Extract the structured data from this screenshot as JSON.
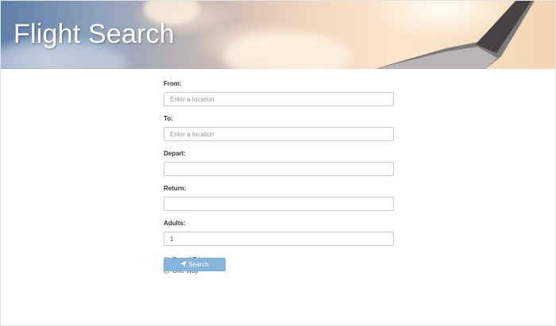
{
  "header": {
    "title": "Flight Search"
  },
  "form": {
    "from": {
      "label": "From:",
      "placeholder": "Enter a location",
      "value": ""
    },
    "to": {
      "label": "To:",
      "placeholder": "Enter a location",
      "value": ""
    },
    "depart": {
      "label": "Depart:",
      "value": ""
    },
    "return": {
      "label": "Return:",
      "value": ""
    },
    "adults": {
      "label": "Adults:",
      "value": "1"
    },
    "trip_type": {
      "options": [
        {
          "label": "Round Trip",
          "selected": true
        },
        {
          "label": "One Way",
          "selected": false
        }
      ]
    },
    "search_button": {
      "label": "Search",
      "icon": "paper-plane-icon"
    }
  },
  "colors": {
    "button_background": "#86b5de",
    "title_text": "#ffffff"
  }
}
